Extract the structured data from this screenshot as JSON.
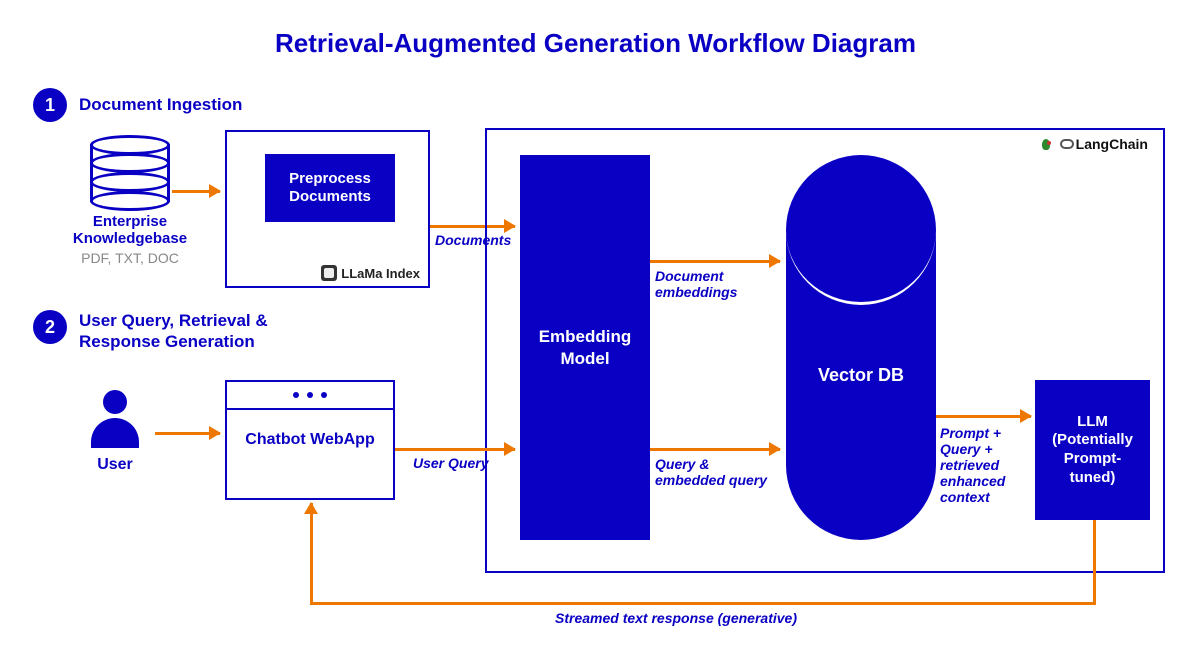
{
  "title": "Retrieval-Augmented Generation Workflow Diagram",
  "steps": {
    "s1": {
      "num": "1",
      "text": "Document Ingestion"
    },
    "s2": {
      "num": "2",
      "text": "User Query, Retrieval & Response Generation"
    }
  },
  "kb": {
    "line1": "Enterprise Knowledgebase",
    "line2": "PDF, TXT, DOC"
  },
  "llama": {
    "preprocess": "Preprocess Documents",
    "tag": "LLaMa Index"
  },
  "langchain": {
    "tag": "LangChain"
  },
  "embed": "Embedding Model",
  "vectordb": "Vector DB",
  "llm": "LLM (Potentially Prompt-tuned)",
  "user": "User",
  "chatbot": "Chatbot WebApp",
  "arrows": {
    "documents": "Documents",
    "doc_embeddings": "Document embeddings",
    "user_query": "User Query",
    "query_embed": "Query & embedded query",
    "prompt_ctx": "Prompt + Query + retrieved enhanced context",
    "stream": "Streamed text response (generative)"
  }
}
